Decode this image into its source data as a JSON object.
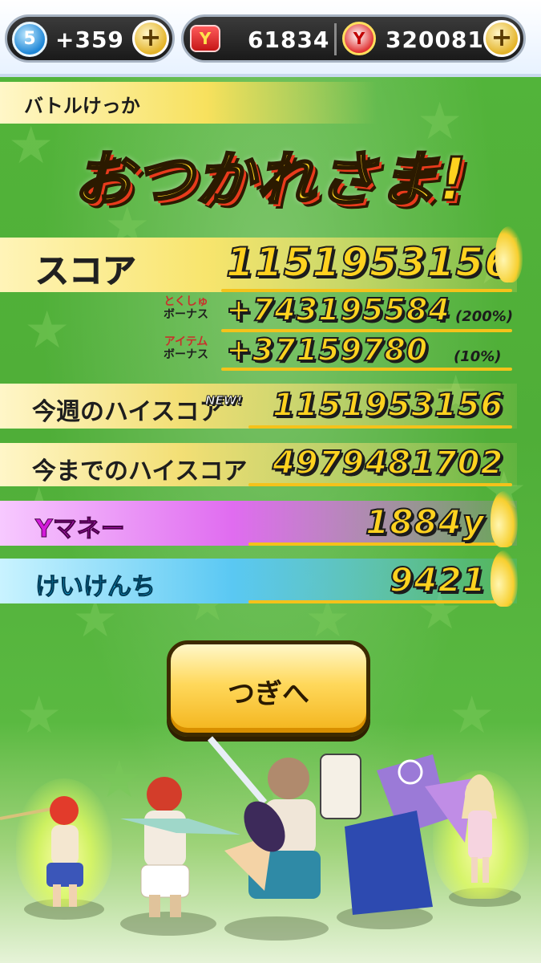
{
  "status_bar": {
    "stamina_level": "5",
    "stamina_plus": "+359",
    "ticket_count": "61834",
    "money_count": "320081",
    "plus_icon": "+"
  },
  "header": {
    "section_label": "バトルけっか",
    "title": "おつかれさま!"
  },
  "results": {
    "score": {
      "label": "スコア",
      "value": "1151953156"
    },
    "special_bonus": {
      "label_line1": "とくしゅ",
      "label_line2": "ボーナス",
      "value": "+743195584",
      "percent": "(200%)"
    },
    "item_bonus": {
      "label_line1": "アイテム",
      "label_line2": "ボーナス",
      "value": "+37159780",
      "percent": "(10%)"
    },
    "weekly_high": {
      "label": "今週のハイスコア",
      "badge": "NEW!",
      "value": "1151953156"
    },
    "all_time_high": {
      "label": "今までのハイスコア",
      "value": "4979481702"
    },
    "money": {
      "label": "Yマネー",
      "value": "1884y"
    },
    "exp": {
      "label": "けいけんち",
      "value": "9421"
    }
  },
  "next_button": {
    "label": "つぎへ"
  },
  "icons": {
    "stamina": "stamina-icon",
    "plus": "plus-icon",
    "ticket": "ticket-icon",
    "money": "money-icon"
  },
  "colors": {
    "background": "#53b53a",
    "score_value": "#ffd21f",
    "title_fill": "#ffd21f",
    "title_shadow": "#e83b1c",
    "money_label": "#d21ad9",
    "exp_label": "#1ab4ec"
  }
}
